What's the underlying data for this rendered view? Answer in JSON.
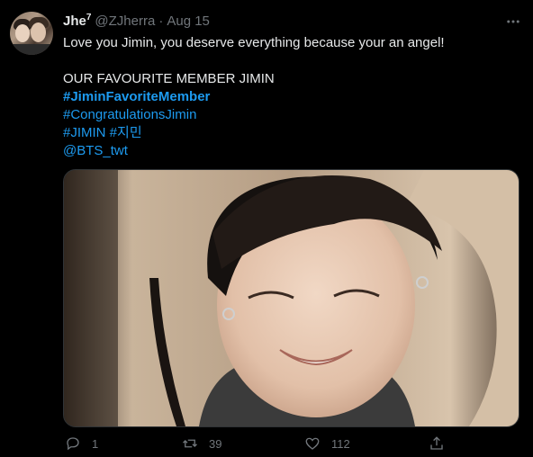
{
  "tweet": {
    "author_name": "Jhe",
    "author_sup": "7",
    "handle": "@ZJherra",
    "separator": "·",
    "date": "Aug 15",
    "lines": [
      "Love you Jimin, you deserve everything because your an angel!",
      "OUR FAVOURITE MEMBER JIMIN"
    ],
    "hashtags": [
      "#JiminFavoriteMember",
      "#CongratulationsJimin",
      "#JIMIN #지민"
    ],
    "mention": "@BTS_twt"
  },
  "actions": {
    "reply_count": "1",
    "retweet_count": "39",
    "like_count": "112"
  },
  "icons": {
    "more": "more-horizontal-icon",
    "reply": "reply-icon",
    "retweet": "retweet-icon",
    "like": "heart-icon",
    "share": "share-icon"
  },
  "colors": {
    "background": "#000000",
    "text": "#e7e9ea",
    "muted": "#71767b",
    "link": "#1d9bf0"
  }
}
